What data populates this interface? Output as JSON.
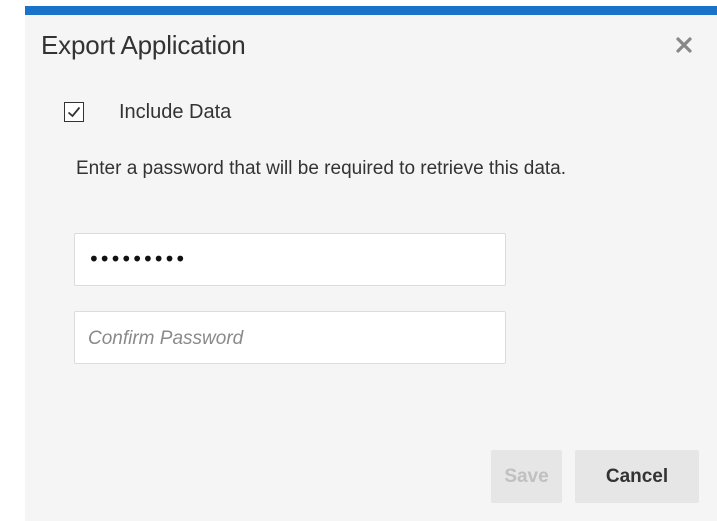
{
  "dialog": {
    "title": "Export Application",
    "close_icon": "close-icon"
  },
  "include_data": {
    "label": "Include Data",
    "checked": true
  },
  "instructions": "Enter a password that will be required to retrieve this data.",
  "password": {
    "value": "•••••••••"
  },
  "confirm_password": {
    "placeholder": "Confirm Password"
  },
  "buttons": {
    "save_label": "Save",
    "cancel_label": "Cancel"
  },
  "colors": {
    "accent": "#1a73c9"
  }
}
